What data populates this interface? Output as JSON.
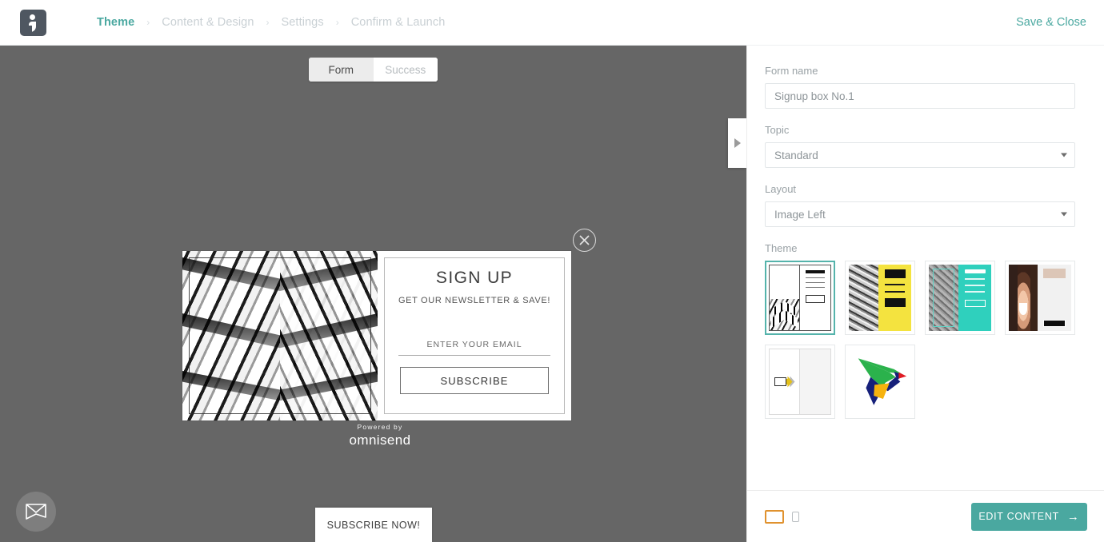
{
  "header": {
    "logo_icon": "omnisend-logo-icon",
    "breadcrumbs": [
      {
        "label": "Theme",
        "state": "active"
      },
      {
        "label": "Content & Design",
        "state": "inactive"
      },
      {
        "label": "Settings",
        "state": "inactive"
      },
      {
        "label": "Confirm & Launch",
        "state": "inactive"
      }
    ],
    "separator": "›",
    "save_close_label": "Save & Close"
  },
  "canvas": {
    "view_tabs": [
      {
        "label": "Form",
        "state": "active"
      },
      {
        "label": "Success",
        "state": "inactive"
      }
    ],
    "collapse_handle_icon": "play-right-icon",
    "popup": {
      "image_alt": "black-and-white-architecture-photo",
      "close_icon": "close-circle-icon",
      "title": "SIGN UP",
      "subtitle": "GET OUR NEWSLETTER & SAVE!",
      "email_placeholder": "ENTER YOUR EMAIL",
      "submit_label": "SUBSCRIBE"
    },
    "powered_by": {
      "prefix": "Powered by",
      "brand": "omnisend"
    },
    "chat_widget_icon": "envelope-icon",
    "teaser_label": "SUBSCRIBE NOW!"
  },
  "panel": {
    "form_name": {
      "label": "Form name",
      "value": "Signup box No.1",
      "placeholder": "Signup box No.1"
    },
    "topic": {
      "label": "Topic",
      "value": "Standard",
      "options": [
        "Standard"
      ]
    },
    "layout": {
      "label": "Layout",
      "value": "Image Left",
      "options": [
        "Image Left"
      ]
    },
    "theme": {
      "label": "Theme",
      "selected_index": 0,
      "accent_color": "#55b3ab",
      "items": [
        {
          "name": "theme-architecture-bw",
          "selected": true
        },
        {
          "name": "theme-rope-yellow",
          "selected": false
        },
        {
          "name": "theme-texture-teal",
          "selected": false
        },
        {
          "name": "theme-portrait-beige",
          "selected": false
        },
        {
          "name": "theme-broken-image",
          "selected": false
        },
        {
          "name": "theme-origami-bird",
          "selected": false
        }
      ]
    },
    "footer": {
      "desktop_icon": "desktop-view-icon",
      "desktop_active_color": "#e0922f",
      "mobile_icon": "mobile-view-icon",
      "mobile_active_color": "#b9bec1",
      "edit_content_label": "EDIT CONTENT",
      "edit_content_arrow": "→",
      "edit_content_color": "#4aa8a0"
    }
  }
}
